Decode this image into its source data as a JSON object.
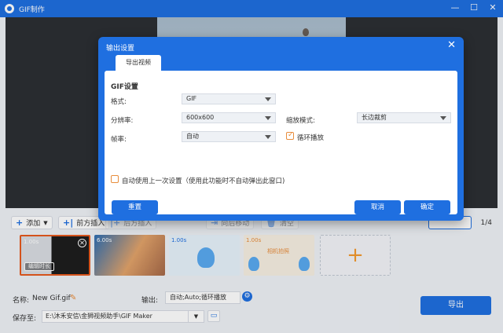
{
  "app": {
    "title": "GIF制作"
  },
  "toolbar": {
    "add_label": "添加",
    "insert_before_label": "前方插入",
    "insert_after_label": "后方插入",
    "move_back_label": "向后移动",
    "clear_label": "清空",
    "pager": "1/4"
  },
  "thumbnails": [
    {
      "duration": "1.00s",
      "edit_label": "编辑时长"
    },
    {
      "duration": "6.00s"
    },
    {
      "duration": "1.00s"
    },
    {
      "duration": "1.00s",
      "caption": "相机拍照"
    }
  ],
  "bottom": {
    "name_label": "名称:",
    "name_value": "New Gif.gif",
    "output_label": "输出:",
    "output_value": "自动;Auto;循环播放",
    "save_label": "保存至:",
    "save_path": "E:\\沐禾安信\\金狮视频助手\\GIF Maker",
    "export_label": "导出"
  },
  "modal": {
    "title": "输出设置",
    "tab_label": "导出视频",
    "section_title": "GIF设置",
    "format_label": "格式:",
    "format_value": "GIF",
    "resolution_label": "分辨率:",
    "resolution_value": "600x600",
    "scale_label": "缩放模式:",
    "scale_value": "长边裁剪",
    "framerate_label": "帧率:",
    "framerate_value": "自动",
    "loop_label": "循环播放",
    "loop_checked": true,
    "reuse_label": "自动使用上一次设置（使用此功能时不自动弹出此窗口)",
    "reuse_checked": false,
    "reset_label": "重置",
    "cancel_label": "取消",
    "ok_label": "确定"
  },
  "colors": {
    "accent": "#1f6fe0",
    "orange": "#e88d3c",
    "preview_bg": "#2c2f33"
  }
}
